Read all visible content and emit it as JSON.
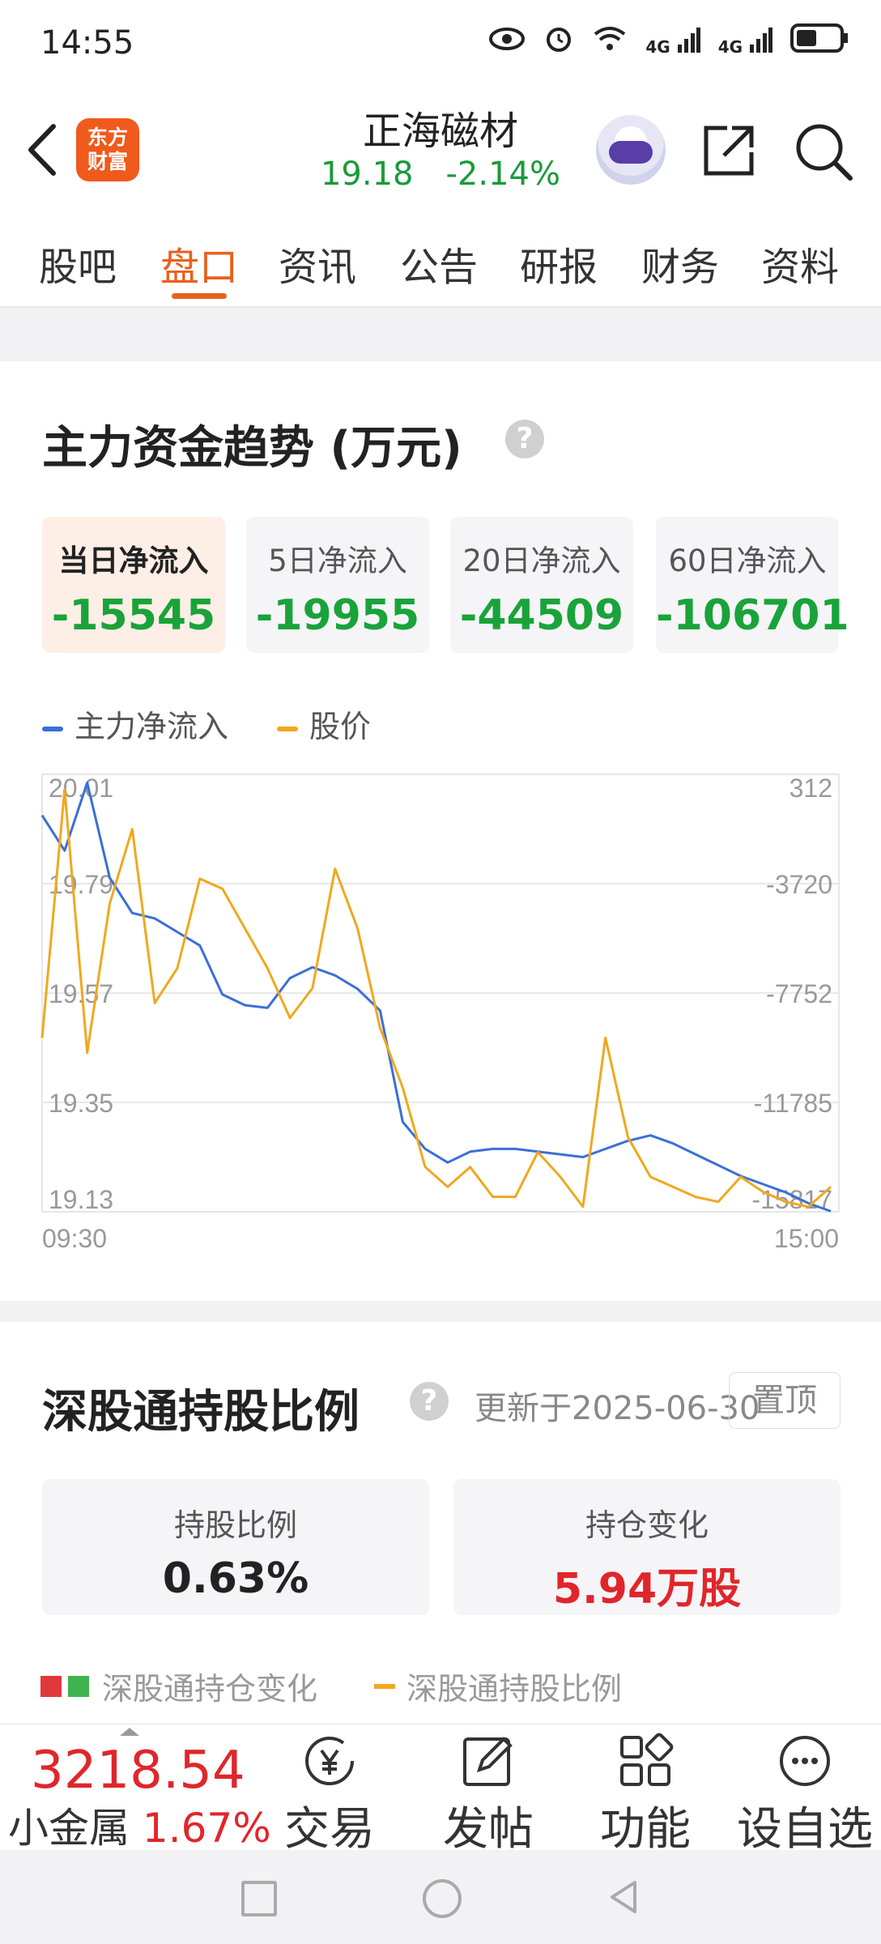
{
  "status": {
    "time": "14:55",
    "net1": "4G",
    "net2": "4G"
  },
  "header": {
    "stock_name": "正海磁材",
    "price": "19.18",
    "change": "-2.14%",
    "logo_top": "东方",
    "logo_bottom": "财富"
  },
  "tabs": [
    "股吧",
    "盘口",
    "资讯",
    "公告",
    "研报",
    "财务",
    "资料"
  ],
  "flow": {
    "title": "主力资金趋势 (万元)",
    "boxes": [
      {
        "label": "当日净流入",
        "value": "-15545"
      },
      {
        "label": "5日净流入",
        "value": "-19955"
      },
      {
        "label": "20日净流入",
        "value": "-44509"
      },
      {
        "label": "60日净流入",
        "value": "-106701"
      }
    ]
  },
  "chart_data": {
    "type": "line",
    "series": [
      {
        "name": "主力净流入",
        "color": "#3a6fd8",
        "axis": "right",
        "values": [
          -1200,
          -2500,
          0,
          -3500,
          -4800,
          -5000,
          -5500,
          -6000,
          -7800,
          -8200,
          -8300,
          -7200,
          -6800,
          -7100,
          -7600,
          -8400,
          -12500,
          -13500,
          -14000,
          -13600,
          -13500,
          -13500,
          -13600,
          -13700,
          -13800,
          -13500,
          -13200,
          -13000,
          -13300,
          -13700,
          -14100,
          -14500,
          -14800,
          -15100,
          -15500,
          -15800
        ]
      },
      {
        "name": "股价",
        "color": "#f0a81f",
        "axis": "left",
        "values": [
          19.48,
          19.98,
          19.45,
          19.75,
          19.9,
          19.55,
          19.62,
          19.8,
          19.78,
          19.7,
          19.62,
          19.52,
          19.58,
          19.82,
          19.7,
          19.5,
          19.38,
          19.22,
          19.18,
          19.22,
          19.16,
          19.16,
          19.25,
          19.2,
          19.14,
          19.48,
          19.28,
          19.2,
          19.18,
          19.16,
          19.15,
          19.2,
          19.17,
          19.15,
          19.14,
          19.18
        ]
      }
    ],
    "x_labels": [
      "09:30",
      "15:00"
    ],
    "y_left_ticks": [
      "20.01",
      "19.79",
      "19.57",
      "19.35",
      "19.13"
    ],
    "y_right_ticks": [
      "312",
      "-3720",
      "-7752",
      "-11785",
      "-15817"
    ],
    "y_left_range": [
      19.13,
      20.01
    ],
    "y_right_range": [
      -15817,
      312
    ],
    "grid": true,
    "legend": "top-left"
  },
  "hold": {
    "title": "深股通持股比例",
    "updated": "更新于2025-06-30",
    "pin": "置顶",
    "ratio_label": "持股比例",
    "ratio_value": "0.63%",
    "change_label": "持仓变化",
    "change_value": "5.94万股",
    "legend1": "深股通持仓变化",
    "legend2": "深股通持股比例"
  },
  "bottom": {
    "index_value": "3218.54",
    "index_name": "小金属",
    "index_change": "1.67%",
    "buttons": [
      "交易",
      "发帖",
      "功能",
      "设自选"
    ]
  }
}
